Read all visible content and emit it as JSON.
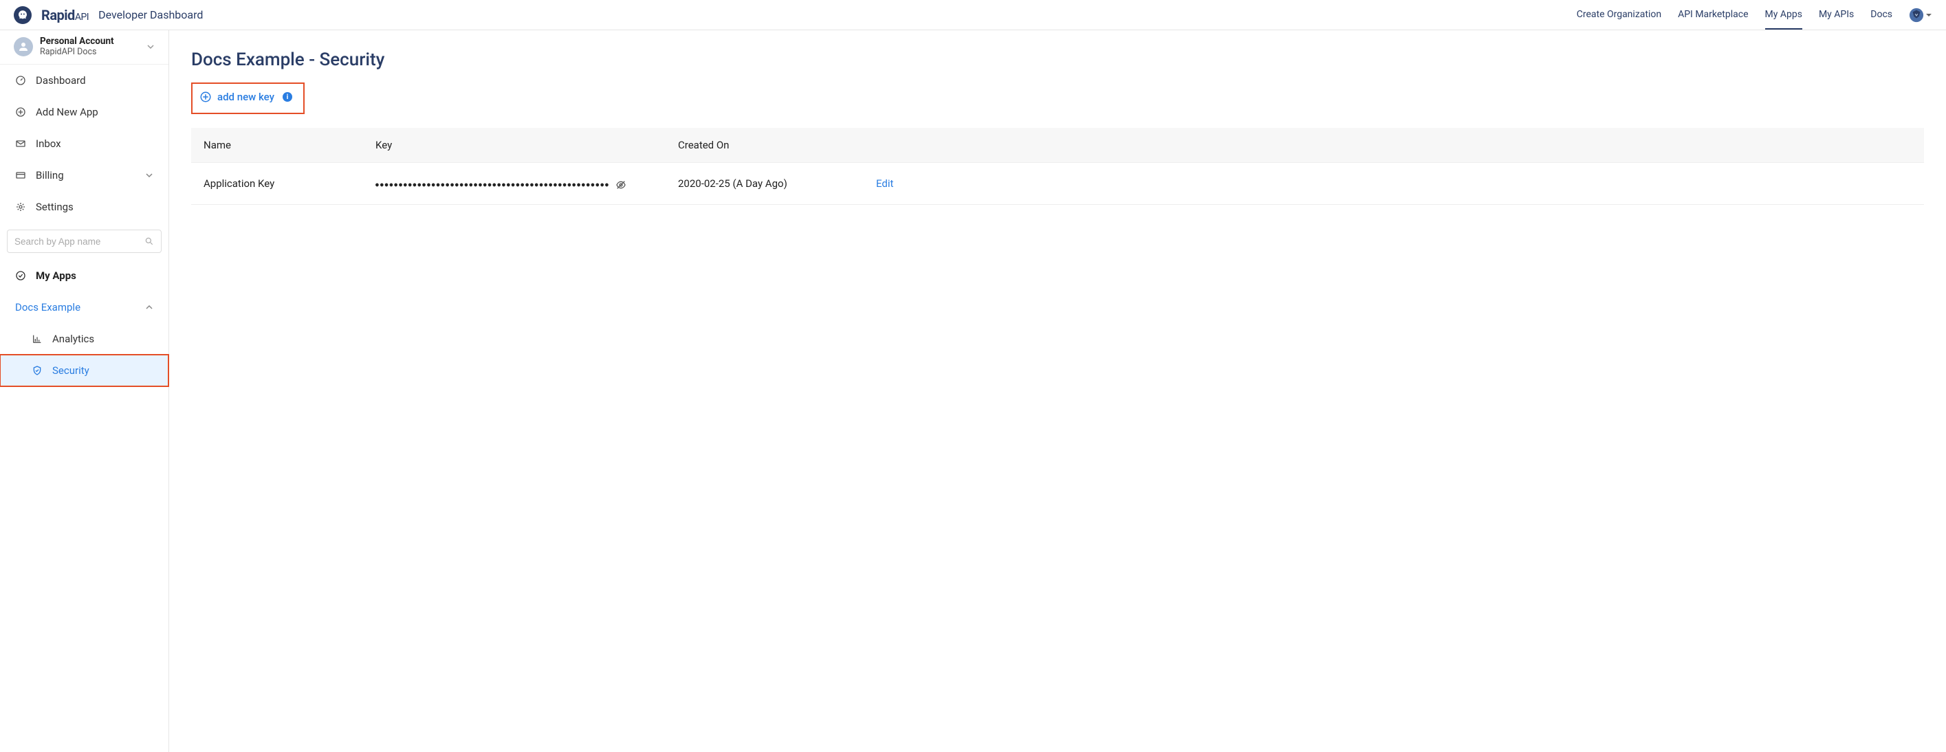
{
  "header": {
    "logo_text_bold": "Rapid",
    "logo_text_light": "API",
    "title": "Developer Dashboard",
    "nav": [
      {
        "label": "Create Organization",
        "active": false
      },
      {
        "label": "API Marketplace",
        "active": false
      },
      {
        "label": "My Apps",
        "active": true
      },
      {
        "label": "My APIs",
        "active": false
      },
      {
        "label": "Docs",
        "active": false
      }
    ]
  },
  "account": {
    "name": "Personal Account",
    "subtitle": "RapidAPI Docs"
  },
  "sidebar": {
    "items": [
      {
        "icon": "gauge",
        "label": "Dashboard"
      },
      {
        "icon": "plus-circle",
        "label": "Add New App"
      },
      {
        "icon": "mail",
        "label": "Inbox"
      },
      {
        "icon": "card",
        "label": "Billing",
        "chevron": true
      },
      {
        "icon": "gear",
        "label": "Settings"
      }
    ],
    "search_placeholder": "Search by App name",
    "my_apps_label": "My Apps",
    "app_group_label": "Docs Example",
    "sub_items": [
      {
        "icon": "bars",
        "label": "Analytics",
        "active": false
      },
      {
        "icon": "shield",
        "label": "Security",
        "active": true
      }
    ]
  },
  "main": {
    "title": "Docs Example - Security",
    "add_key_label": "add new key",
    "table": {
      "headers": {
        "name": "Name",
        "key": "Key",
        "created": "Created On"
      },
      "rows": [
        {
          "name": "Application Key",
          "key_masked": "●●●●●●●●●●●●●●●●●●●●●●●●●●●●●●●●●●●●●●●●●●●●●●●●●●",
          "created": "2020-02-25 (A Day Ago)",
          "action": "Edit"
        }
      ]
    }
  }
}
